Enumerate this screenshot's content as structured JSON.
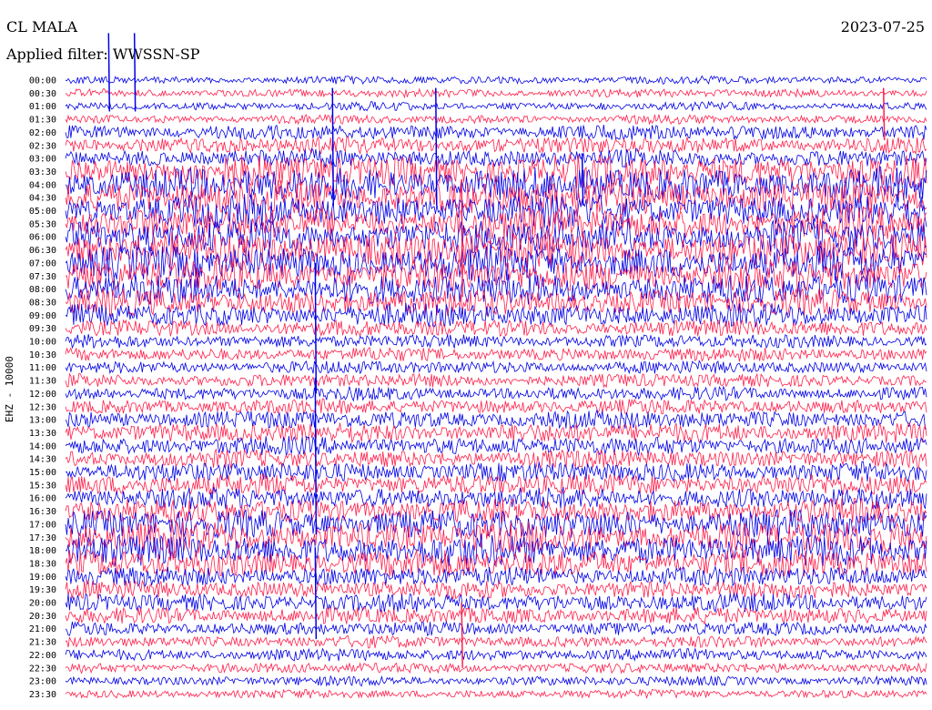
{
  "header": {
    "station": "CL MALA",
    "filter": "Applied filter: WWSSN-SP",
    "date": "2023-07-25",
    "channel": "EHZ - 10000"
  },
  "colors": {
    "odd": "#0000e6",
    "even": "#ff1f4b",
    "background": "#ffffff"
  },
  "chart_data": {
    "type": "line",
    "title": "CL MALA",
    "subtitle": "Applied filter: WWSSN-SP",
    "ylabel": "EHZ - 10000",
    "xlabel": "",
    "grid": false,
    "y_tick_labels": [
      "00:00",
      "00:30",
      "01:00",
      "01:30",
      "02:00",
      "02:30",
      "03:00",
      "03:30",
      "04:00",
      "04:30",
      "05:00",
      "05:30",
      "06:00",
      "06:30",
      "07:00",
      "07:30",
      "08:00",
      "08:30",
      "09:00",
      "09:30",
      "10:00",
      "10:30",
      "11:00",
      "11:30",
      "12:00",
      "12:30",
      "13:00",
      "13:30",
      "14:00",
      "14:30",
      "15:00",
      "15:30",
      "16:00",
      "16:30",
      "17:00",
      "17:30",
      "18:00",
      "18:30",
      "19:00",
      "19:30",
      "20:00",
      "20:30",
      "21:00",
      "21:30",
      "22:00",
      "22:30",
      "23:00",
      "23:30"
    ],
    "row_activity": [
      0.12,
      0.14,
      0.14,
      0.16,
      0.35,
      0.4,
      0.45,
      0.9,
      0.95,
      0.95,
      0.9,
      0.9,
      0.95,
      1.0,
      0.95,
      0.9,
      0.85,
      0.7,
      0.6,
      0.4,
      0.3,
      0.3,
      0.28,
      0.3,
      0.3,
      0.35,
      0.45,
      0.5,
      0.45,
      0.45,
      0.5,
      0.55,
      0.55,
      0.65,
      0.8,
      0.85,
      0.85,
      0.75,
      0.5,
      0.45,
      0.45,
      0.4,
      0.3,
      0.25,
      0.25,
      0.2,
      0.18,
      0.15
    ],
    "spikes": [
      {
        "time": "00:00",
        "x_frac": 0.05,
        "height": 6.0
      },
      {
        "time": "00:00",
        "x_frac": 0.08,
        "height": 6.0
      },
      {
        "time": "01:30",
        "x_frac": 0.95,
        "height": 4.0
      },
      {
        "time": "03:00",
        "x_frac": 0.31,
        "height": 9.0
      },
      {
        "time": "03:00",
        "x_frac": 0.43,
        "height": 9.0
      },
      {
        "time": "04:00",
        "x_frac": 0.6,
        "height": 4.0
      },
      {
        "time": "06:30",
        "x_frac": 0.46,
        "height": 9.0
      },
      {
        "time": "10:00",
        "x_frac": 0.29,
        "height": 10.0
      },
      {
        "time": "15:00",
        "x_frac": 0.29,
        "height": 12.0
      },
      {
        "time": "20:00",
        "x_frac": 0.29,
        "height": 7.0
      },
      {
        "time": "21:30",
        "x_frac": 0.46,
        "height": 5.0
      }
    ]
  }
}
